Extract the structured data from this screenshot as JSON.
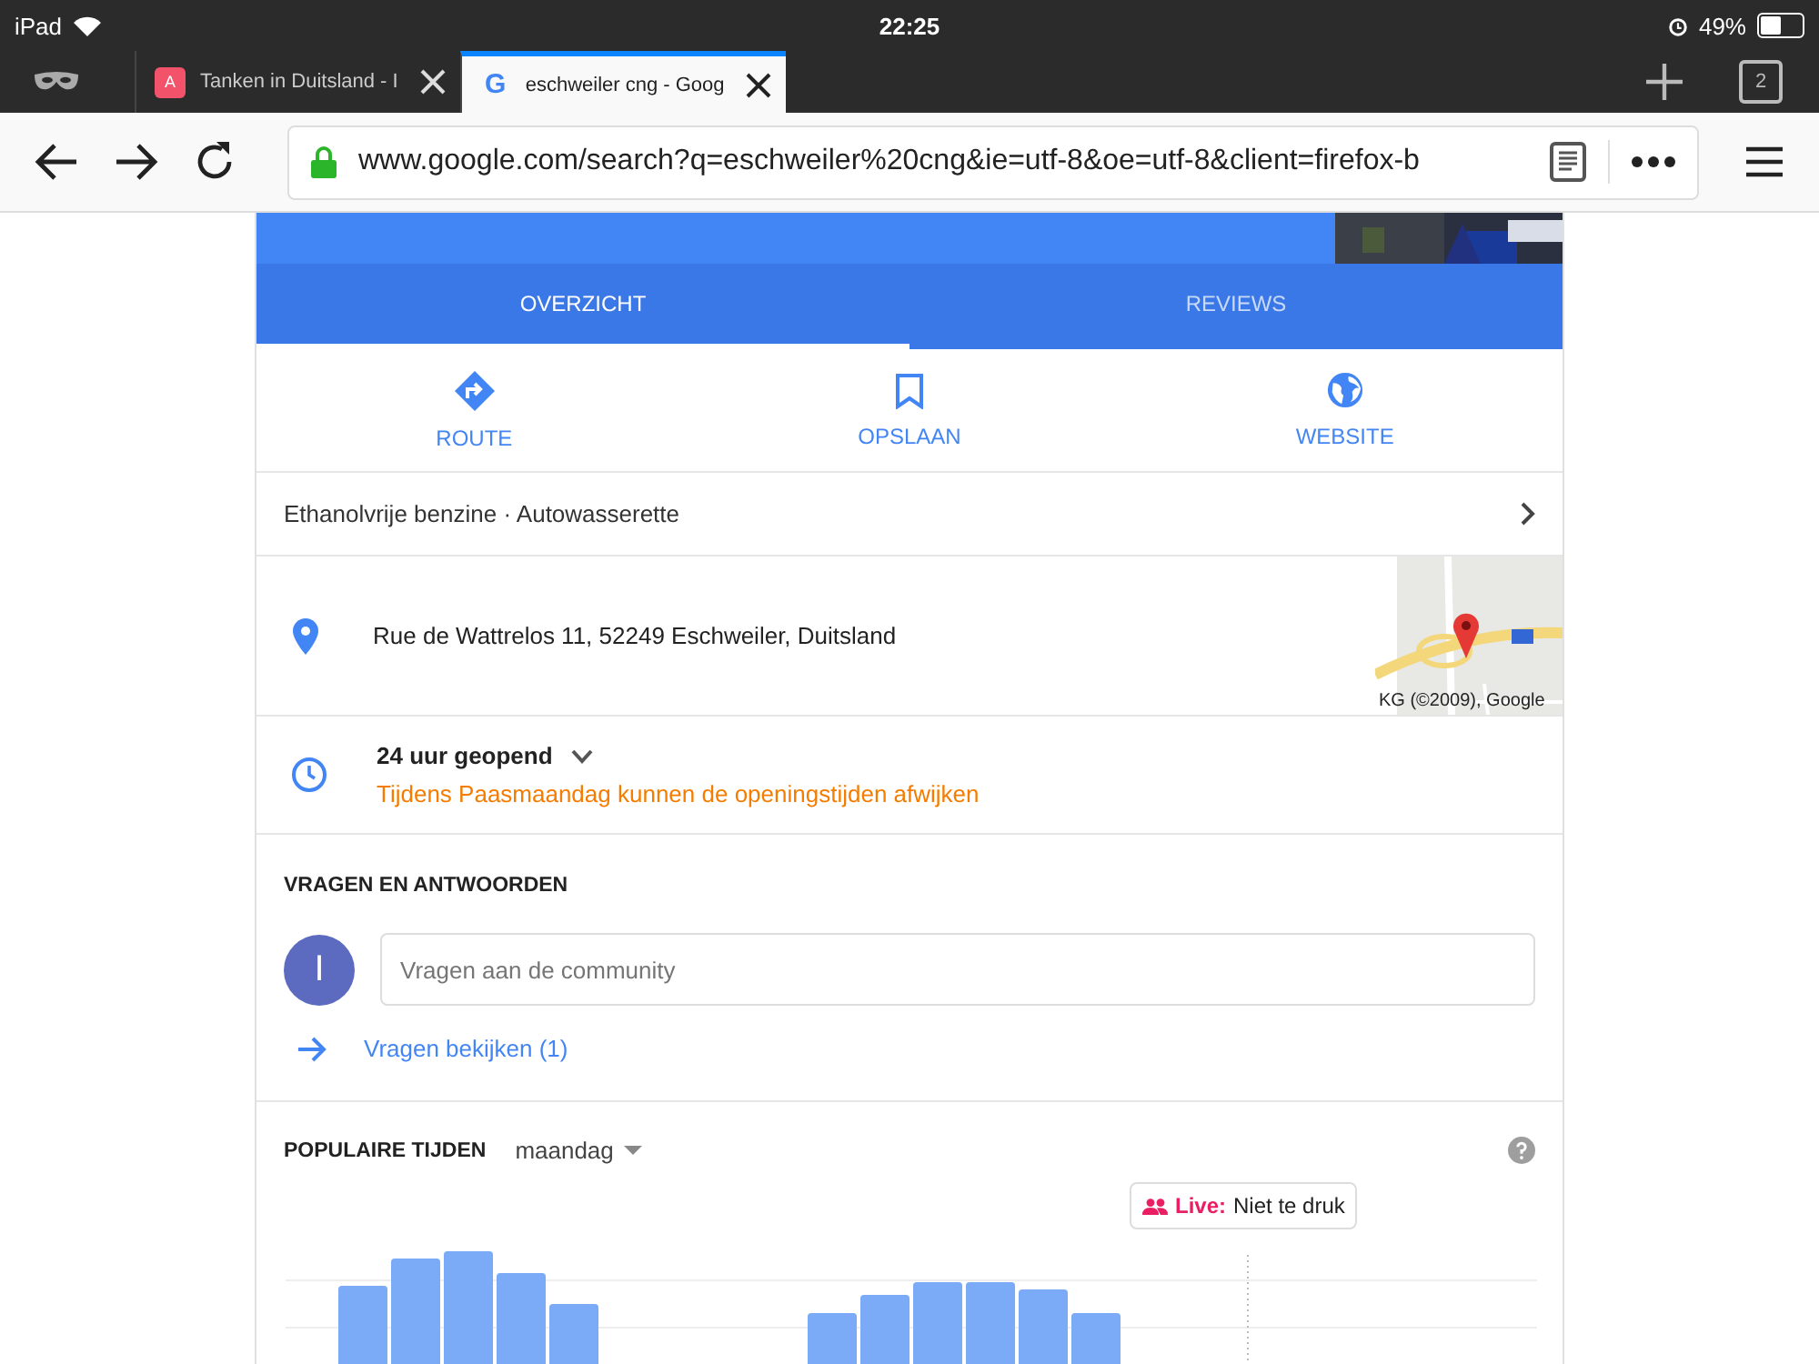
{
  "status_bar": {
    "device": "iPad",
    "time": "22:25",
    "battery": "49%"
  },
  "browser_tabs": [
    {
      "title": "Tanken in Duitsland - I",
      "favicon": {
        "text": "A",
        "kind": "badge"
      },
      "selected": false
    },
    {
      "title": "eschweiler cng - Goog",
      "favicon": {
        "text": "G",
        "kind": "letter"
      },
      "selected": true
    }
  ],
  "tab_count": "2",
  "url": "www.google.com/search?q=eschweiler%20cng&ie=utf-8&oe=utf-8&client=firefox-b",
  "place_tabs": [
    {
      "label": "OVERZICHT",
      "selected": true
    },
    {
      "label": "REVIEWS",
      "selected": false
    }
  ],
  "actions": [
    {
      "label": "ROUTE",
      "kind": "route"
    },
    {
      "label": "OPSLAAN",
      "kind": "save"
    },
    {
      "label": "WEBSITE",
      "kind": "website"
    }
  ],
  "category": "Ethanolvrije benzine · Autowasserette",
  "address": "Rue de Wattrelos 11, 52249 Eschweiler, Duitsland",
  "map_attribution": "KG (©2009), Google",
  "hours": {
    "title": "24 uur geopend",
    "expanded": false,
    "notice": "Tijdens Paasmaandag kunnen de openingstijden afwijken"
  },
  "questions": {
    "heading": "VRAGEN EN ANTWOORDEN",
    "avatar": "I",
    "placeholder": "Vragen aan de community",
    "link": "Vragen bekijken (1)"
  },
  "popular_times": {
    "heading": "POPULAIRE TIJDEN",
    "day": "maandag",
    "live_label": "Live:",
    "live_status": "Niet te druk"
  }
}
